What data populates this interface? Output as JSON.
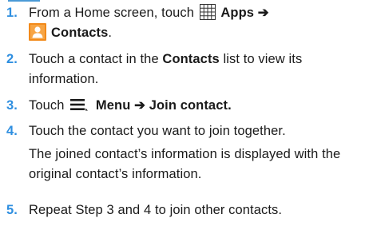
{
  "steps": [
    {
      "number": "1.",
      "line1": {
        "prefix": "From a Home screen, touch",
        "apps_label": "Apps",
        "arrow": "➔",
        "apps_icon": "apps-grid-icon"
      },
      "line2": {
        "contacts_label": "Contacts",
        "suffix": ".",
        "contacts_icon": "contacts-person-icon"
      }
    },
    {
      "number": "2.",
      "line1": {
        "prefix": "Touch a contact in the",
        "bold": "Contacts",
        "suffix": "list to view its"
      },
      "line2": {
        "text": "information."
      }
    },
    {
      "number": "3.",
      "line1": {
        "prefix": "Touch",
        "menu_label": "Menu",
        "arrow": "➔",
        "join_label": "Join contact.",
        "menu_icon": "menu-lines-icon"
      }
    },
    {
      "number": "4.",
      "line1": {
        "text": "Touch the contact you want to join together."
      },
      "line2": {
        "text": "The joined contact’s information is displayed with the"
      },
      "line3": {
        "text": "original contact’s information."
      }
    },
    {
      "number": "5.",
      "line1": {
        "text": "Repeat Step 3 and 4 to join other contacts."
      }
    }
  ],
  "colors": {
    "step_number": "#2f8fe0",
    "accent_rule": "#4a9ad6",
    "contacts_icon_bg": "#f28a1a",
    "text": "#1a1a1a"
  }
}
